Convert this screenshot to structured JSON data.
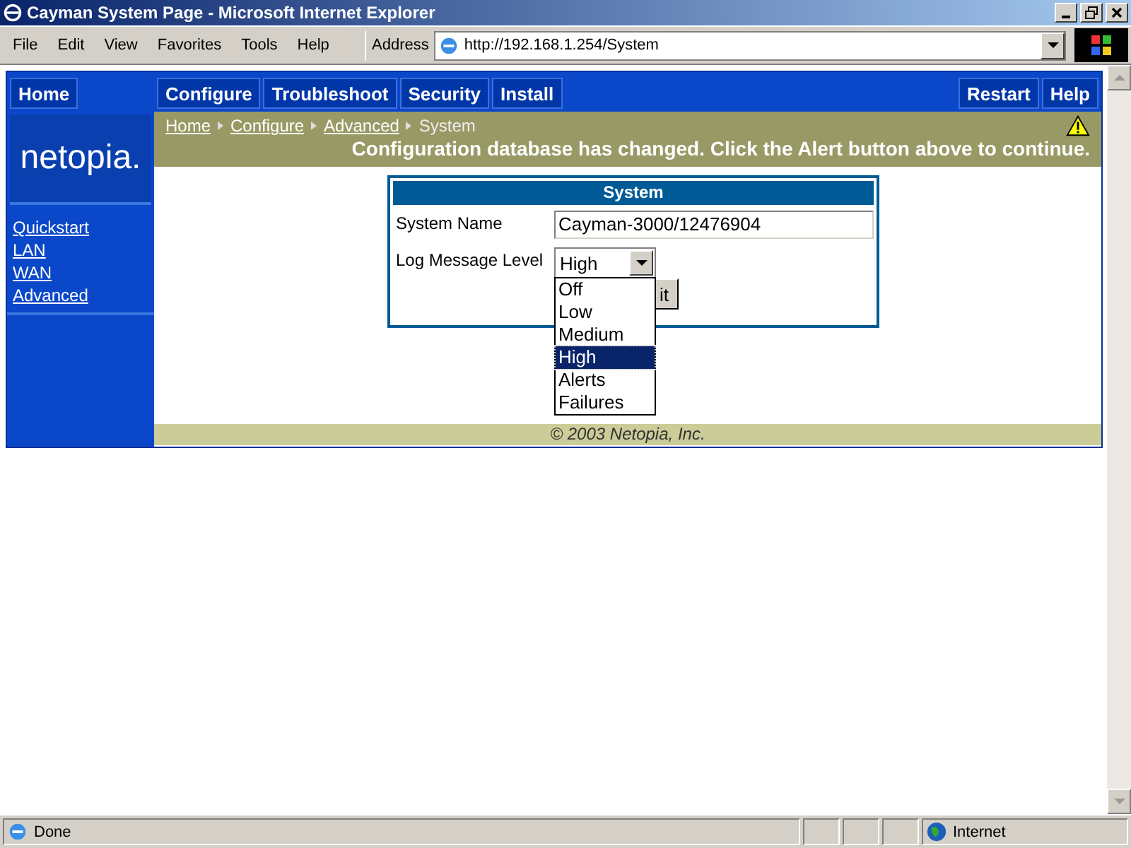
{
  "window": {
    "title": "Cayman System Page - Microsoft Internet Explorer"
  },
  "menu": [
    "File",
    "Edit",
    "View",
    "Favorites",
    "Tools",
    "Help"
  ],
  "address": {
    "label": "Address",
    "value": "http://192.168.1.254/System"
  },
  "nav_left": [
    "Home"
  ],
  "nav_tabs": [
    "Configure",
    "Troubleshoot",
    "Security",
    "Install"
  ],
  "nav_right": [
    "Restart",
    "Help"
  ],
  "logo": "netopia.",
  "sidebar": [
    "Quickstart",
    "LAN",
    "WAN",
    "Advanced"
  ],
  "breadcrumb": {
    "links": [
      "Home",
      "Configure",
      "Advanced"
    ],
    "current": "System"
  },
  "alert": "Configuration database has changed. Click the Alert button above to continue.",
  "form": {
    "title": "System",
    "fields": [
      {
        "kind": "text",
        "label": "System Name",
        "value": "Cayman-3000/12476904"
      },
      {
        "kind": "select",
        "label": "Log Message Level",
        "value": "High",
        "options": [
          {
            "label": "Off",
            "selected": false
          },
          {
            "label": "Low",
            "selected": false
          },
          {
            "label": "Medium",
            "selected": false
          },
          {
            "label": "High",
            "selected": true
          },
          {
            "label": "Alerts",
            "selected": false
          },
          {
            "label": "Failures",
            "selected": false
          }
        ]
      }
    ],
    "button": "it"
  },
  "footer": "© 2003 Netopia, Inc.",
  "status_bar": {
    "text": "Done",
    "zone": "Internet"
  }
}
